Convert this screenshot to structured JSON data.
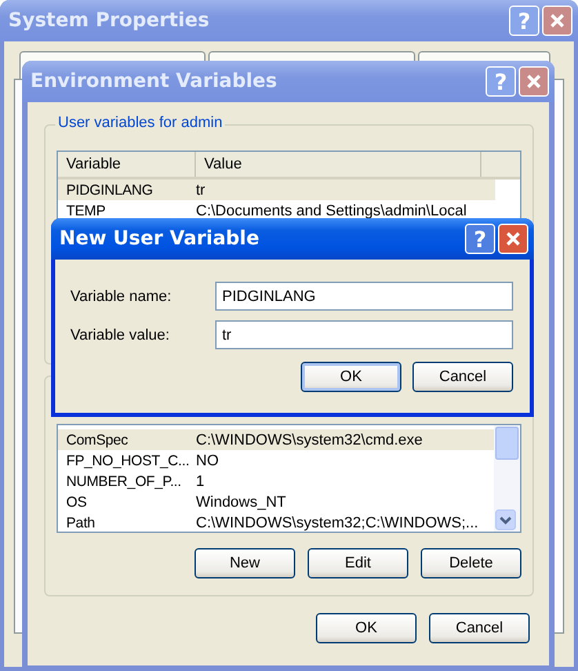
{
  "system_properties": {
    "title": "System Properties",
    "help": "?"
  },
  "environment_variables": {
    "title": "Environment Variables",
    "help": "?",
    "user_variables": {
      "label": "User variables for admin",
      "columns": [
        "Variable",
        "Value"
      ],
      "rows": [
        {
          "variable": "PIDGINLANG",
          "value": "tr",
          "selected": true
        },
        {
          "variable": "TEMP",
          "value": "C:\\Documents and Settings\\admin\\Local",
          "selected": false
        }
      ]
    },
    "system_variables": {
      "rows": [
        {
          "variable": "ComSpec",
          "value": "C:\\WINDOWS\\system32\\cmd.exe",
          "selected": true
        },
        {
          "variable": "FP_NO_HOST_C...",
          "value": "NO",
          "selected": false
        },
        {
          "variable": "NUMBER_OF_P...",
          "value": "1",
          "selected": false
        },
        {
          "variable": "OS",
          "value": "Windows_NT",
          "selected": false
        },
        {
          "variable": "Path",
          "value": "C:\\WINDOWS\\system32;C:\\WINDOWS;...",
          "selected": false
        }
      ],
      "buttons": [
        "New",
        "Edit",
        "Delete"
      ]
    },
    "buttons": [
      "OK",
      "Cancel"
    ]
  },
  "new_user_variable": {
    "title": "New User Variable",
    "help": "?",
    "fields": [
      {
        "label": "Variable name:",
        "value": "PIDGINLANG"
      },
      {
        "label": "Variable value:",
        "value": "tr"
      }
    ],
    "buttons": [
      {
        "label": "OK",
        "default": true
      },
      {
        "label": "Cancel",
        "default": false
      }
    ]
  }
}
